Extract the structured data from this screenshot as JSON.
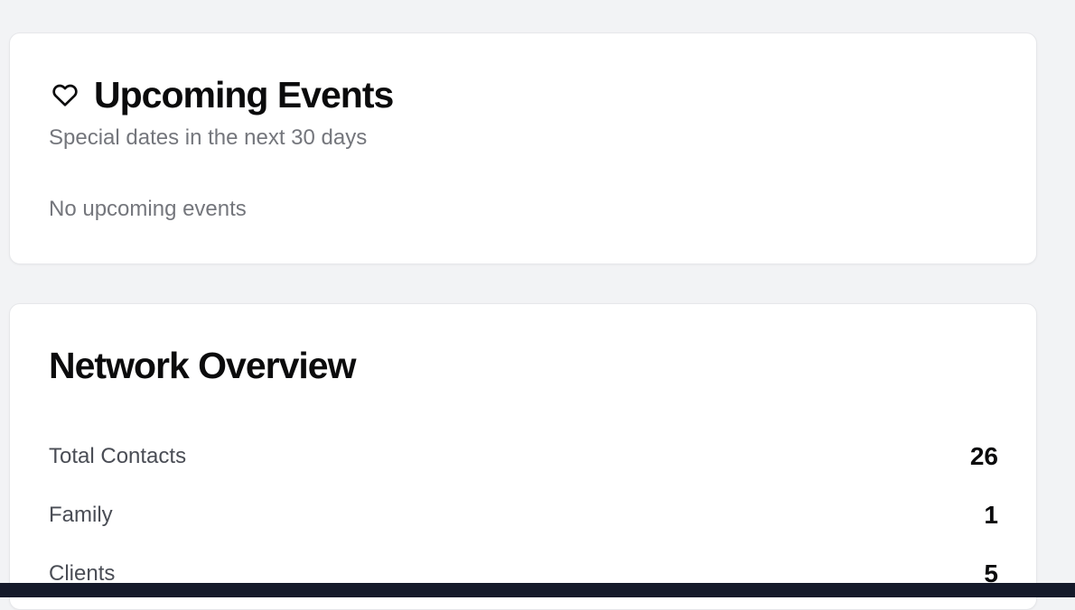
{
  "events_card": {
    "icon": "heart-icon",
    "title": "Upcoming Events",
    "subtitle": "Special dates in the next 30 days",
    "empty_message": "No upcoming events"
  },
  "network_card": {
    "title": "Network Overview",
    "stats": [
      {
        "label": "Total Contacts",
        "value": "26"
      },
      {
        "label": "Family",
        "value": "1"
      },
      {
        "label": "Clients",
        "value": "5"
      }
    ]
  },
  "colors": {
    "background": "#f2f3f5",
    "card": "#ffffff",
    "muted_text": "#74767c",
    "bottom_bar": "#151a2a"
  }
}
